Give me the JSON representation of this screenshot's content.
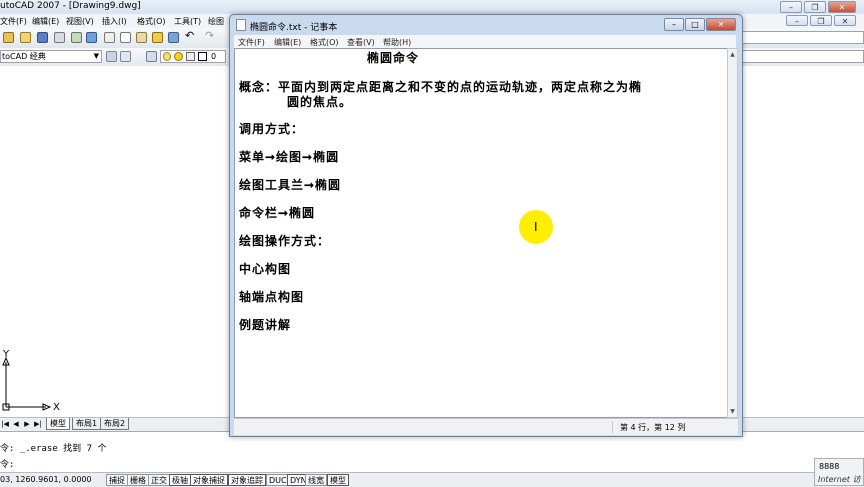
{
  "acad": {
    "title": "utoCAD 2007 - [Drawing9.dwg]",
    "menu": [
      "文件(F)",
      "编辑(E)",
      "视图(V)",
      "插入(I)",
      "格式(O)",
      "工具(T)",
      "绘图"
    ],
    "workspace": "toCAD 经典",
    "layer_value": "0",
    "tabs": [
      "模型",
      "布局1",
      "布局2"
    ],
    "cmd_history": "令: _.erase 找到 7 个",
    "cmd_prompt": "令:",
    "coords": "03, 1260.9601, 0.0000",
    "status_buttons": [
      "捕捉",
      "栅格",
      "正交",
      "极轴",
      "对象捕捉",
      "对象追踪",
      "DUCS",
      "DYN",
      "线宽",
      "模型"
    ],
    "ucs_x": "X",
    "ucs_y": "Y",
    "tray_number": "8888",
    "tray_text": "Internet 访"
  },
  "notepad": {
    "title": "椭圆命令.txt - 记事本",
    "menu": [
      "文件(F)",
      "编辑(E)",
      "格式(O)",
      "查看(V)",
      "帮助(H)"
    ],
    "lines": [
      "椭圆命令",
      "概念：平面内到两定点距离之和不变的点的运动轨迹，两定点称之为椭",
      "圆的焦点。",
      "调用方式：",
      "菜单➞绘图➞椭圆",
      "绘图工具兰➞椭圆",
      "命令栏➞椭圆",
      "绘图操作方式：",
      "中心构图",
      "轴端点构图",
      "例题讲解"
    ],
    "status": "第 4 行，第 12 列"
  },
  "colors": {
    "cursor_highlight": "#ffee00",
    "title_bar": "#c9daee"
  }
}
